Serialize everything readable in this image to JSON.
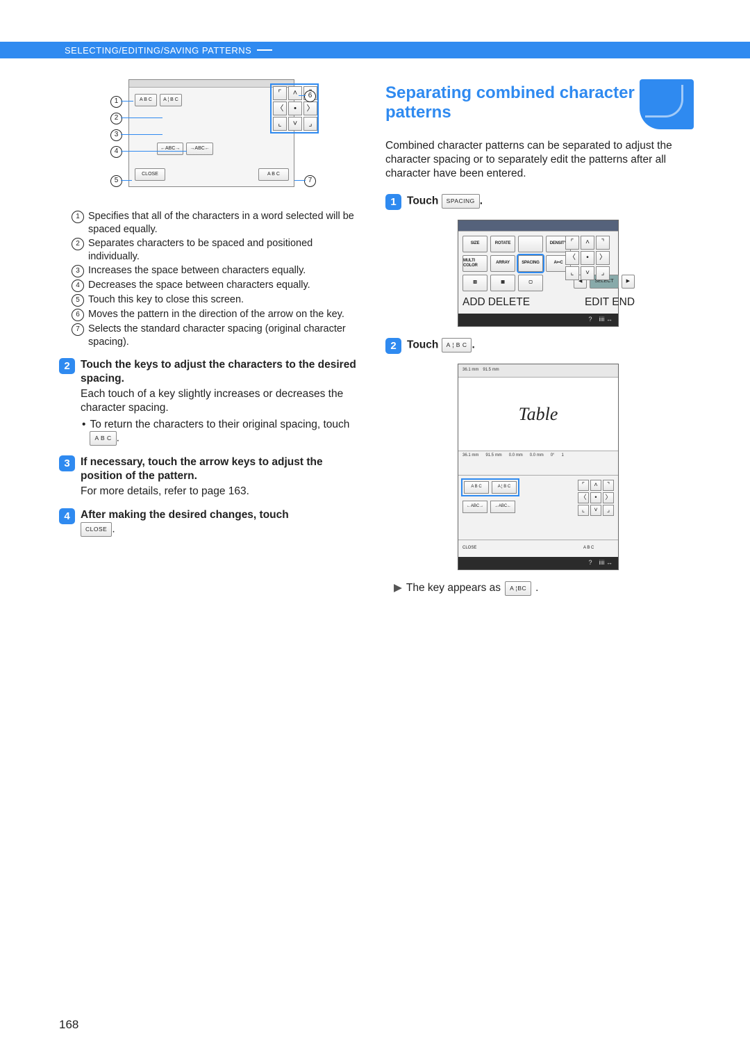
{
  "header": {
    "title": "SELECTING/EDITING/SAVING PATTERNS"
  },
  "page_number": "168",
  "diagram1": {
    "callouts": [
      "1",
      "2",
      "3",
      "4",
      "5",
      "6",
      "7"
    ],
    "btn_abc_equal": "A B C",
    "btn_abc_sep": "A ¦ B C",
    "btn_dec": "←ABC→",
    "btn_inc": "→ABC←",
    "btn_close": "CLOSE",
    "btn_std": "A B C"
  },
  "legend": {
    "items": [
      "Specifies that all of the characters in a word selected will be spaced equally.",
      "Separates characters to be spaced and positioned individually.",
      "Increases the space between characters equally.",
      "Decreases the space between characters equally.",
      "Touch this key to close this screen.",
      "Moves the pattern in the direction of the arrow on the key.",
      "Selects the standard character spacing (original character spacing)."
    ]
  },
  "left_steps": {
    "s2": {
      "title": "Touch the keys to adjust the characters to the desired spacing.",
      "body": "Each touch of a key slightly increases or decreases the character spacing.",
      "bullet": "To return the characters to their original spacing, touch",
      "key": "A B C",
      "tail": "."
    },
    "s3": {
      "title": "If necessary, touch the arrow keys to adjust the position of the pattern.",
      "body": "For more details, refer to page 163."
    },
    "s4": {
      "title": "After making the desired changes, touch",
      "key": "CLOSE",
      "tail": "."
    }
  },
  "right": {
    "heading": "Separating combined character patterns",
    "intro": "Combined character patterns can be separated to adjust the character spacing or to separately edit the patterns after all character have been entered.",
    "s1": {
      "pre": "Touch",
      "key": "SPACING",
      "post": "."
    },
    "s2": {
      "pre": "Touch",
      "key": "A ¦ B C",
      "post": "."
    },
    "result": {
      "text": "The key appears as",
      "key": "A ¦BC",
      "post": "."
    }
  },
  "shot1": {
    "btns": [
      "SIZE",
      "ROTATE",
      "",
      "DENSITY",
      "MULTI COLOR",
      "ARRAY",
      "SPACING",
      "A✂C"
    ],
    "hl_index": 6,
    "sel": {
      "left": "◀",
      "mid": "SELECT",
      "right": "▶"
    },
    "add": "ADD",
    "del": "DELETE",
    "editend": "EDIT END",
    "bottom": {
      "a": "?",
      "b": "iiii ↔"
    }
  },
  "shot2": {
    "preview_text": "Table",
    "dims_top": {
      "a": "36.1 mm",
      "b": "91.5 mm"
    },
    "mid": {
      "a": "36.1 mm",
      "b": "91.5 mm",
      "c": "0.0 mm",
      "d": "0.0 mm",
      "e": "0°",
      "f": "1"
    },
    "kA": "A B C",
    "kB": "A ¦ B C",
    "kC": "←ABC→",
    "kD": "→ABC←",
    "close": "CLOSE",
    "std": "A B C",
    "bottom": {
      "a": "?",
      "b": "iiii ↔"
    }
  }
}
